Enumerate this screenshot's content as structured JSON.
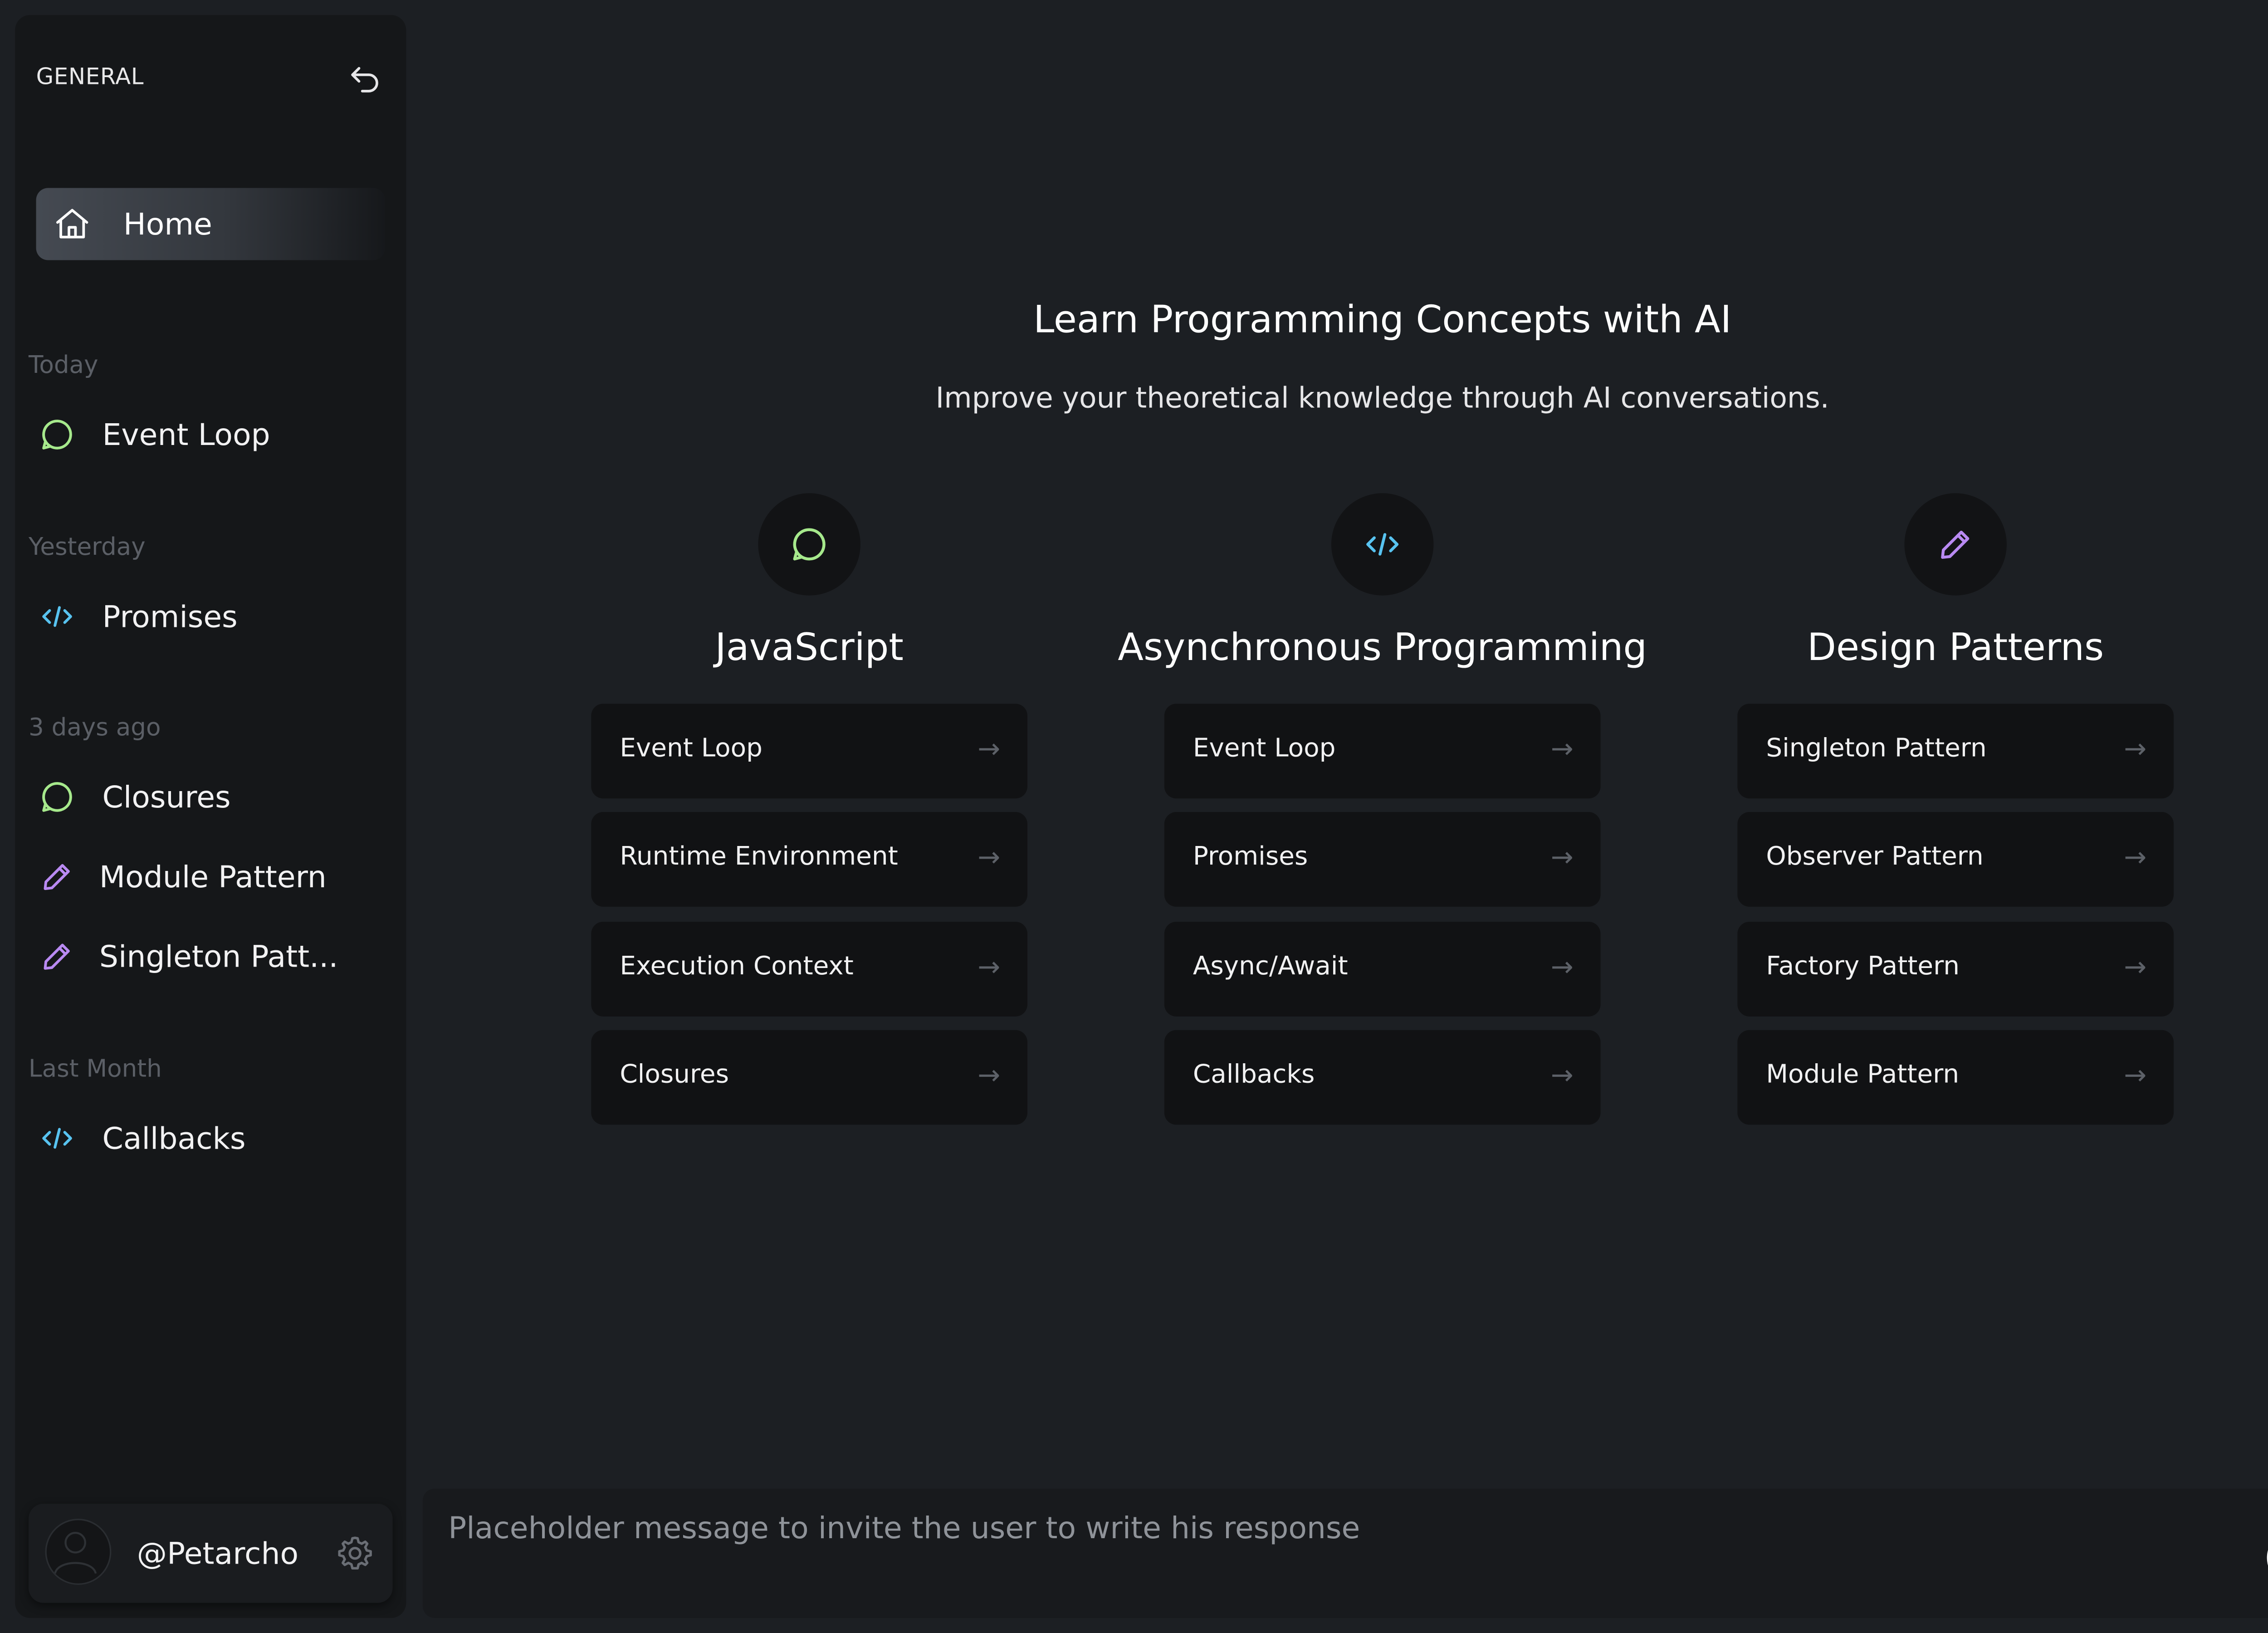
{
  "colors": {
    "chat_icon": "#a6e98c",
    "code_icon": "#58c3f0",
    "pen_icon": "#b98af2"
  },
  "sidebar": {
    "title": "GENERAL",
    "collapse_icon": "undo-arrow-icon",
    "home_label": "Home",
    "groups": [
      {
        "label": "Today",
        "items": [
          {
            "label": "Event Loop",
            "icon": "chat-bubble-icon"
          }
        ]
      },
      {
        "label": "Yesterday",
        "items": [
          {
            "label": "Promises",
            "icon": "code-icon"
          }
        ]
      },
      {
        "label": "3 days ago",
        "items": [
          {
            "label": "Closures",
            "icon": "chat-bubble-icon"
          },
          {
            "label": "Module Pattern",
            "icon": "pencil-icon"
          },
          {
            "label": "Singleton Patt...",
            "icon": "pencil-icon"
          }
        ]
      },
      {
        "label": "Last Month",
        "items": [
          {
            "label": "Callbacks",
            "icon": "code-icon"
          }
        ]
      }
    ],
    "user": {
      "name": "@Petarcho"
    }
  },
  "main": {
    "title": "Learn Programming Concepts with AI",
    "subtitle": "Improve your theoretical knowledge through AI conversations.",
    "arrow_glyph": "→",
    "columns": [
      {
        "title": "JavaScript",
        "icon": "chat-bubble-icon",
        "topics": [
          "Event Loop",
          "Runtime Environment",
          "Execution Context",
          "Closures"
        ]
      },
      {
        "title": "Asynchronous Programming",
        "icon": "code-icon",
        "topics": [
          "Event Loop",
          "Promises",
          "Async/Await",
          "Callbacks"
        ]
      },
      {
        "title": "Design Patterns",
        "icon": "pencil-icon",
        "topics": [
          "Singleton Pattern",
          "Observer Pattern",
          "Factory Pattern",
          "Module Pattern"
        ]
      }
    ]
  },
  "composer": {
    "placeholder": "Placeholder message to invite the user to write his response",
    "value": ""
  }
}
